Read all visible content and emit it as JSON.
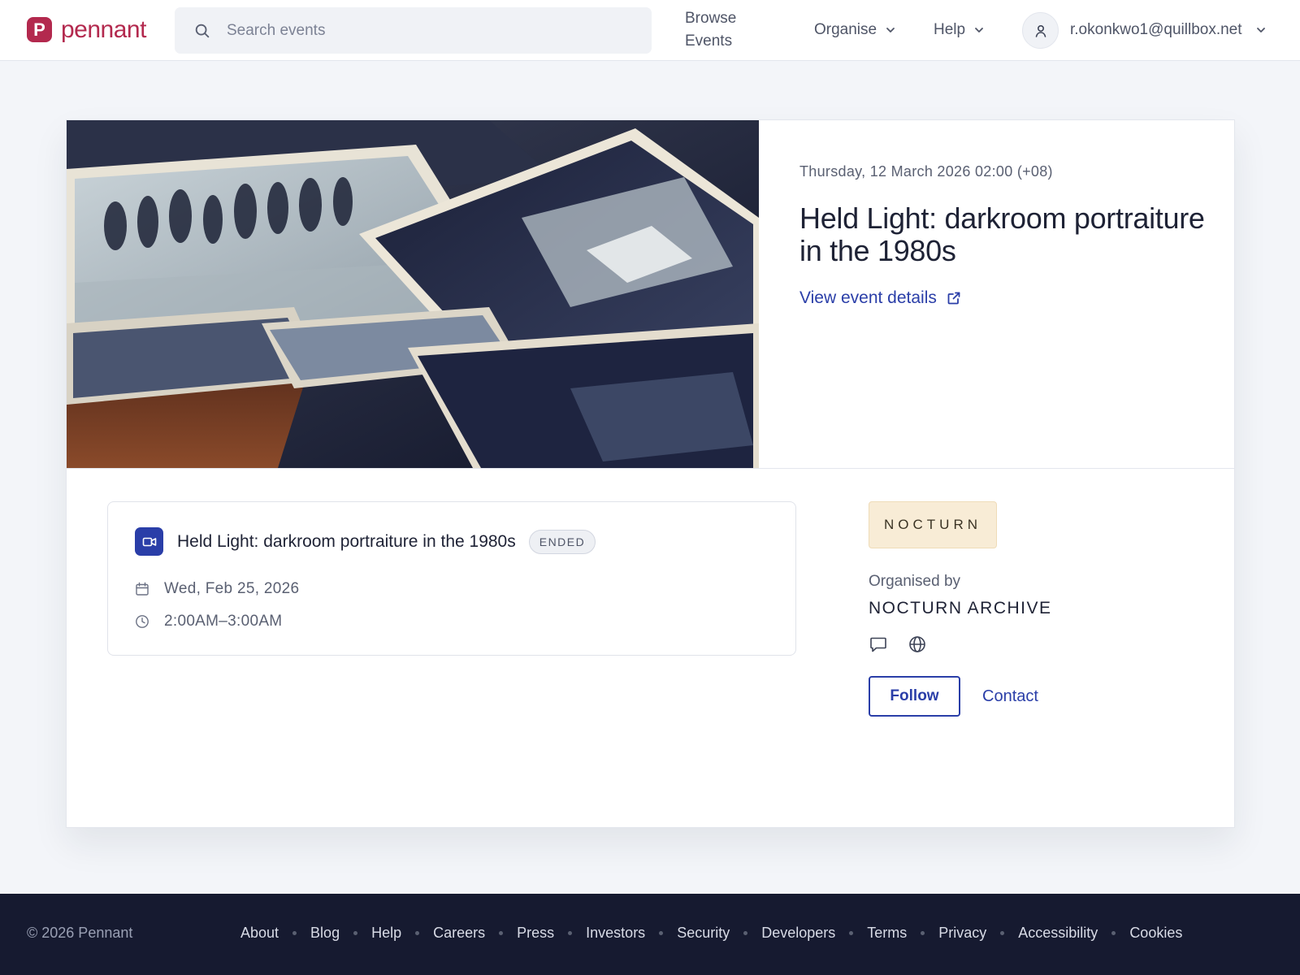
{
  "header": {
    "brand_letter": "P",
    "brand_name": "pennant",
    "brand_color": "#b3294e",
    "search_placeholder": "Search events",
    "nav": {
      "browse": "Browse Events",
      "organise": "Organise",
      "help": "Help"
    },
    "user_email": "r.okonkwo1@quillbox.net"
  },
  "event": {
    "datetime": "Thursday, 12 March 2026 02:00 (+08)",
    "title": "Held Light: darkroom portraiture in the 1980s",
    "details_link": "View event details"
  },
  "session": {
    "title": "Held Light: darkroom portraiture in the 1980s",
    "status": "ENDED",
    "date": "Wed, Feb 25, 2026",
    "time": "2:00AM–3:00AM"
  },
  "organiser": {
    "tag": "NOCTURN",
    "label": "Organised by",
    "name": "NOCTURN ARCHIVE",
    "follow_label": "Follow",
    "contact_label": "Contact"
  },
  "footer": {
    "copyright": "© 2026 Pennant",
    "links": [
      "About",
      "Blog",
      "Help",
      "Careers",
      "Press",
      "Investors",
      "Security",
      "Developers",
      "Terms",
      "Privacy",
      "Accessibility",
      "Cookies"
    ]
  },
  "colors": {
    "accent": "#2a3ea8",
    "footer_bg": "#161a30",
    "tag_bg": "#f8ecd6"
  }
}
